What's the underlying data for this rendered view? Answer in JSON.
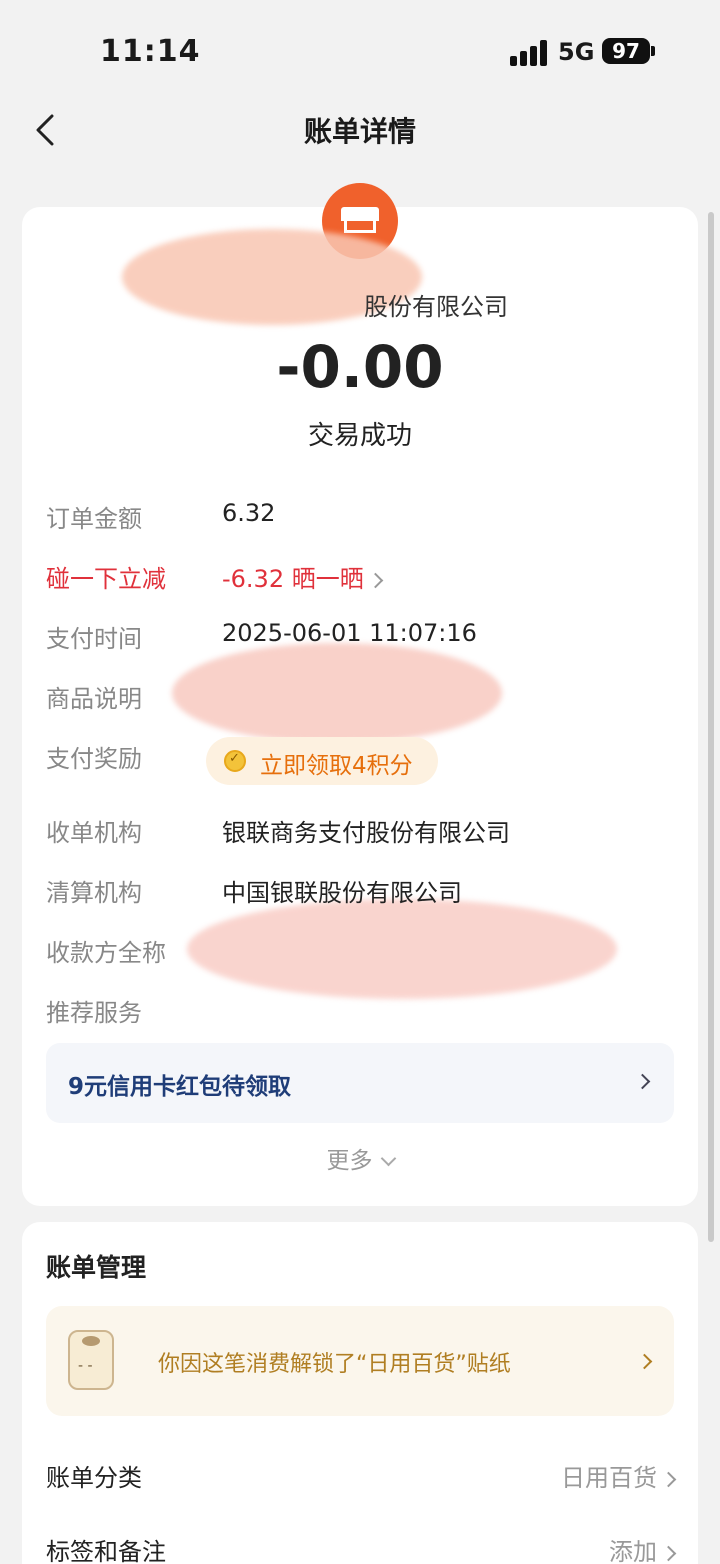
{
  "status": {
    "time": "11:14",
    "network": "5G",
    "battery": "97"
  },
  "nav": {
    "title": "账单详情"
  },
  "merchant": {
    "name": "股份有限公司",
    "amount": "-0.00",
    "status": "交易成功"
  },
  "details": [
    {
      "label": "订单金额",
      "value": "6.32"
    },
    {
      "label": "碰一下立减",
      "value": "-6.32 晒一晒"
    },
    {
      "label": "支付时间",
      "value": "2025-06-01 11:07:16"
    },
    {
      "label": "商品说明",
      "value": ""
    },
    {
      "label": "支付奖励",
      "value": ""
    },
    {
      "label": "收单机构",
      "value": "银联商务支付股份有限公司"
    },
    {
      "label": "清算机构",
      "value": "中国银联股份有限公司"
    },
    {
      "label": "收款方全称",
      "value": ""
    },
    {
      "label": "推荐服务",
      "value": ""
    }
  ],
  "reward": {
    "label": "立即领取4积分"
  },
  "promo": {
    "label": "9元信用卡红包待领取"
  },
  "more": {
    "label": "更多"
  },
  "manage": {
    "title": "账单管理",
    "sticker_banner": "你因这笔消费解锁了“日用百货”贴纸",
    "rows": [
      {
        "label": "账单分类",
        "value": "日用百货"
      },
      {
        "label": "标签和备注",
        "value": "添加"
      }
    ]
  },
  "colors": {
    "accent_red": "#e0313b",
    "reward_orange": "#e66f0c",
    "promo_blue": "#1f3d78",
    "merchant_logo": "#f0612c"
  }
}
